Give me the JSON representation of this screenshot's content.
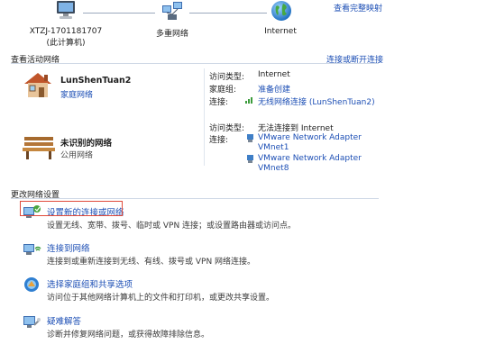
{
  "header": {
    "full_map_link": "查看完整映射",
    "nodes": [
      {
        "label_line1": "XTZJ-1701181707",
        "label_line2": "(此计算机)"
      },
      {
        "label_line1": "多重网络",
        "label_line2": ""
      },
      {
        "label_line1": "Internet",
        "label_line2": ""
      }
    ]
  },
  "active": {
    "title": "查看活动网络",
    "connect_link": "连接或断开连接",
    "networks": [
      {
        "name": "LunShenTuan2",
        "type": "家庭网络",
        "access_key": "访问类型:",
        "access_val": "Internet",
        "homegroup_key": "家庭组:",
        "homegroup_val": "准备创建",
        "conn_key": "连接:",
        "conn_val": "无线网络连接 (LunShenTuan2)"
      },
      {
        "name": "未识别的网络",
        "type": "公用网络",
        "access_key": "访问类型:",
        "access_val": "无法连接到 Internet",
        "conn_key": "连接:",
        "conn_vals": [
          "VMware Network Adapter VMnet1",
          "VMware Network Adapter VMnet8"
        ],
        "conn_lines": [
          [
            "VMware Network Adapter",
            "VMnet1"
          ],
          [
            "VMware Network Adapter",
            "VMnet8"
          ]
        ]
      }
    ]
  },
  "change": {
    "title": "更改网络设置",
    "tasks": [
      {
        "title": "设置新的连接或网络",
        "desc": "设置无线、宽带、拨号、临时或 VPN 连接；或设置路由器或访问点。"
      },
      {
        "title": "连接到网络",
        "desc": "连接到或重新连接到无线、有线、拨号或 VPN 网络连接。"
      },
      {
        "title": "选择家庭组和共享选项",
        "desc": "访问位于其他网络计算机上的文件和打印机，或更改共享设置。"
      },
      {
        "title": "疑难解答",
        "desc": "诊断并修复网络问题，或获得故障排除信息。"
      }
    ]
  }
}
